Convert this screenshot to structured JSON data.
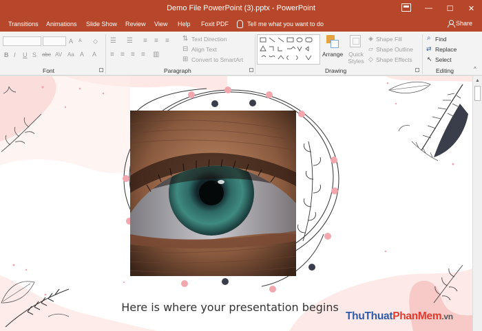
{
  "window": {
    "title": "Demo File PowerPoint (3).pptx  -  PowerPoint",
    "minimize_label": "—",
    "maximize_label": "☐",
    "close_label": "✕"
  },
  "tabs": [
    {
      "label": "Transitions"
    },
    {
      "label": "Animations"
    },
    {
      "label": "Slide Show"
    },
    {
      "label": "Review"
    },
    {
      "label": "View"
    },
    {
      "label": "Help"
    },
    {
      "label": "Foxit PDF"
    }
  ],
  "tell_me": "Tell me what you want to do",
  "share_label": "Share",
  "ribbon": {
    "groups": {
      "font": "Font",
      "paragraph": "Paragraph",
      "drawing": "Drawing",
      "editing": "Editing"
    },
    "font_buttons": [
      "B",
      "I",
      "U",
      "S",
      "abc",
      "AV",
      "Aa",
      "A",
      "A"
    ],
    "grow_font": "A",
    "shrink_font": "A",
    "text_direction": "Text Direction",
    "align_text": "Align Text",
    "convert_smartart": "Convert to SmartArt",
    "arrange": "Arrange",
    "quick_styles": "Quick Styles",
    "shape_fill": "Shape Fill",
    "shape_outline": "Shape Outline",
    "shape_effects": "Shape Effects",
    "find": "Find",
    "replace": "Replace",
    "select": "Select"
  },
  "slide": {
    "caption": "Here is where your presentation begins"
  },
  "watermark": {
    "part1": "ThuThuat",
    "part2": "PhanMem",
    "part3": ".vn"
  },
  "colors": {
    "accent": "#b7472a",
    "blush": "#f7c9c7",
    "pink_dot": "#f2a6ad",
    "dark_dot": "#3a3d4a"
  }
}
